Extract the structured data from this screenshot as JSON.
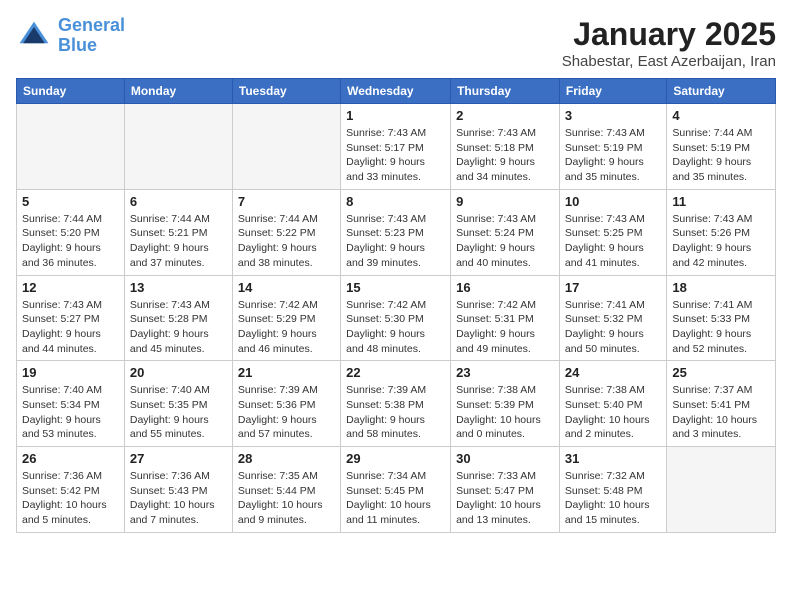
{
  "header": {
    "logo_line1": "General",
    "logo_line2": "Blue",
    "month_year": "January 2025",
    "location": "Shabestar, East Azerbaijan, Iran"
  },
  "weekdays": [
    "Sunday",
    "Monday",
    "Tuesday",
    "Wednesday",
    "Thursday",
    "Friday",
    "Saturday"
  ],
  "weeks": [
    [
      {
        "day": "",
        "info": ""
      },
      {
        "day": "",
        "info": ""
      },
      {
        "day": "",
        "info": ""
      },
      {
        "day": "1",
        "info": "Sunrise: 7:43 AM\nSunset: 5:17 PM\nDaylight: 9 hours\nand 33 minutes."
      },
      {
        "day": "2",
        "info": "Sunrise: 7:43 AM\nSunset: 5:18 PM\nDaylight: 9 hours\nand 34 minutes."
      },
      {
        "day": "3",
        "info": "Sunrise: 7:43 AM\nSunset: 5:19 PM\nDaylight: 9 hours\nand 35 minutes."
      },
      {
        "day": "4",
        "info": "Sunrise: 7:44 AM\nSunset: 5:19 PM\nDaylight: 9 hours\nand 35 minutes."
      }
    ],
    [
      {
        "day": "5",
        "info": "Sunrise: 7:44 AM\nSunset: 5:20 PM\nDaylight: 9 hours\nand 36 minutes."
      },
      {
        "day": "6",
        "info": "Sunrise: 7:44 AM\nSunset: 5:21 PM\nDaylight: 9 hours\nand 37 minutes."
      },
      {
        "day": "7",
        "info": "Sunrise: 7:44 AM\nSunset: 5:22 PM\nDaylight: 9 hours\nand 38 minutes."
      },
      {
        "day": "8",
        "info": "Sunrise: 7:43 AM\nSunset: 5:23 PM\nDaylight: 9 hours\nand 39 minutes."
      },
      {
        "day": "9",
        "info": "Sunrise: 7:43 AM\nSunset: 5:24 PM\nDaylight: 9 hours\nand 40 minutes."
      },
      {
        "day": "10",
        "info": "Sunrise: 7:43 AM\nSunset: 5:25 PM\nDaylight: 9 hours\nand 41 minutes."
      },
      {
        "day": "11",
        "info": "Sunrise: 7:43 AM\nSunset: 5:26 PM\nDaylight: 9 hours\nand 42 minutes."
      }
    ],
    [
      {
        "day": "12",
        "info": "Sunrise: 7:43 AM\nSunset: 5:27 PM\nDaylight: 9 hours\nand 44 minutes."
      },
      {
        "day": "13",
        "info": "Sunrise: 7:43 AM\nSunset: 5:28 PM\nDaylight: 9 hours\nand 45 minutes."
      },
      {
        "day": "14",
        "info": "Sunrise: 7:42 AM\nSunset: 5:29 PM\nDaylight: 9 hours\nand 46 minutes."
      },
      {
        "day": "15",
        "info": "Sunrise: 7:42 AM\nSunset: 5:30 PM\nDaylight: 9 hours\nand 48 minutes."
      },
      {
        "day": "16",
        "info": "Sunrise: 7:42 AM\nSunset: 5:31 PM\nDaylight: 9 hours\nand 49 minutes."
      },
      {
        "day": "17",
        "info": "Sunrise: 7:41 AM\nSunset: 5:32 PM\nDaylight: 9 hours\nand 50 minutes."
      },
      {
        "day": "18",
        "info": "Sunrise: 7:41 AM\nSunset: 5:33 PM\nDaylight: 9 hours\nand 52 minutes."
      }
    ],
    [
      {
        "day": "19",
        "info": "Sunrise: 7:40 AM\nSunset: 5:34 PM\nDaylight: 9 hours\nand 53 minutes."
      },
      {
        "day": "20",
        "info": "Sunrise: 7:40 AM\nSunset: 5:35 PM\nDaylight: 9 hours\nand 55 minutes."
      },
      {
        "day": "21",
        "info": "Sunrise: 7:39 AM\nSunset: 5:36 PM\nDaylight: 9 hours\nand 57 minutes."
      },
      {
        "day": "22",
        "info": "Sunrise: 7:39 AM\nSunset: 5:38 PM\nDaylight: 9 hours\nand 58 minutes."
      },
      {
        "day": "23",
        "info": "Sunrise: 7:38 AM\nSunset: 5:39 PM\nDaylight: 10 hours\nand 0 minutes."
      },
      {
        "day": "24",
        "info": "Sunrise: 7:38 AM\nSunset: 5:40 PM\nDaylight: 10 hours\nand 2 minutes."
      },
      {
        "day": "25",
        "info": "Sunrise: 7:37 AM\nSunset: 5:41 PM\nDaylight: 10 hours\nand 3 minutes."
      }
    ],
    [
      {
        "day": "26",
        "info": "Sunrise: 7:36 AM\nSunset: 5:42 PM\nDaylight: 10 hours\nand 5 minutes."
      },
      {
        "day": "27",
        "info": "Sunrise: 7:36 AM\nSunset: 5:43 PM\nDaylight: 10 hours\nand 7 minutes."
      },
      {
        "day": "28",
        "info": "Sunrise: 7:35 AM\nSunset: 5:44 PM\nDaylight: 10 hours\nand 9 minutes."
      },
      {
        "day": "29",
        "info": "Sunrise: 7:34 AM\nSunset: 5:45 PM\nDaylight: 10 hours\nand 11 minutes."
      },
      {
        "day": "30",
        "info": "Sunrise: 7:33 AM\nSunset: 5:47 PM\nDaylight: 10 hours\nand 13 minutes."
      },
      {
        "day": "31",
        "info": "Sunrise: 7:32 AM\nSunset: 5:48 PM\nDaylight: 10 hours\nand 15 minutes."
      },
      {
        "day": "",
        "info": ""
      }
    ]
  ]
}
